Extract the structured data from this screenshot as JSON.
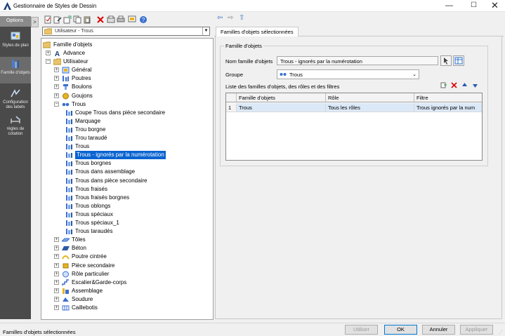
{
  "window": {
    "title": "Gestionnaire de Styles de Dessin"
  },
  "rail": {
    "options_label": "Options",
    "items": [
      {
        "label": "Styles de plan"
      },
      {
        "label": "Famille d'objets"
      },
      {
        "label": "Configuration des labels"
      },
      {
        "label": "règles de cotation"
      }
    ]
  },
  "combo": {
    "value": "Utilisateur - Trous"
  },
  "tree": {
    "root": "Famille d'objets",
    "nodes": [
      "Advance",
      "Utilisateur",
      "Général",
      "Poutres",
      "Boulons",
      "Goujons",
      "Trous",
      "Coupe Trous dans pièce secondaire",
      "Marquage",
      "Trou borgne",
      "Trou taraudé",
      "Trous",
      "Trous - ignorés par la numérotation",
      "Trous borgnes",
      "Trous dans assemblage",
      "Trous dans pièce secondaire",
      "Trous fraisés",
      "Trous fraisés borgnes",
      "Trous oblongs",
      "Trous spéciaux",
      "Trous spéciaux_1",
      "Trous taraudés",
      "Tôles",
      "Béton",
      "Poutre cintrée",
      "Pièce secondaire",
      "Rôle particulier",
      "Escalier&Garde-corps",
      "Assemblage",
      "Soudure",
      "Caillebotis"
    ]
  },
  "panel": {
    "tab": "Familles d'objets sélectionnées",
    "group_title": "Famille d'objets",
    "name_label": "Nom famille d'objets",
    "name_value": "Trous - ignorés par la numérotation",
    "group_label": "Groupe",
    "group_value": "Trous",
    "list_label": "Liste des familles d'objets, des rôles et des filtres",
    "columns": [
      "Famille d'objets",
      "Rôle",
      "Filtre"
    ],
    "rows": [
      {
        "num": "1",
        "famille": "Trous",
        "role": "Tous les rôles",
        "filtre": "Trous ignorés par la num"
      }
    ]
  },
  "status": {
    "text": "Familles d'objets sélectionnées"
  },
  "buttons": {
    "use": "Utiliser",
    "ok": "OK",
    "cancel": "Annuler",
    "apply": "Appliquer"
  }
}
